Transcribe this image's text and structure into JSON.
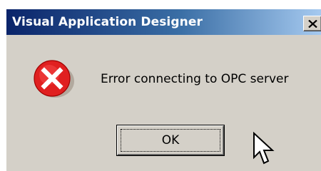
{
  "dialog": {
    "title": "Visual Application Designer",
    "message": "Error connecting to OPC server",
    "ok_label": "OK",
    "icon": "error-icon",
    "close_icon": "close-icon"
  },
  "colors": {
    "titlebar_start": "#0a246a",
    "titlebar_end": "#a6caf0",
    "dialog_bg": "#d4d0c8",
    "error_red": "#e02020"
  }
}
